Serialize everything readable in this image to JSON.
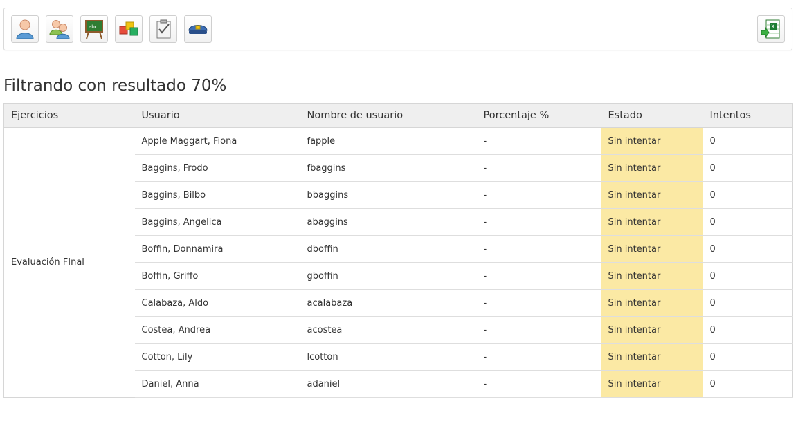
{
  "toolbar": {
    "buttons": [
      {
        "icon": "user-icon"
      },
      {
        "icon": "users-icon"
      },
      {
        "icon": "blackboard-icon"
      },
      {
        "icon": "cubes-icon"
      },
      {
        "icon": "clipboard-check-icon"
      },
      {
        "icon": "security-badge-icon"
      }
    ],
    "export": {
      "icon": "excel-export-icon"
    }
  },
  "page_title": "Filtrando con resultado 70%",
  "table": {
    "headers": [
      "Ejercicios",
      "Usuario",
      "Nombre de usuario",
      "Porcentaje %",
      "Estado",
      "Intentos"
    ],
    "exercise": "Evaluación FInal",
    "rows": [
      {
        "usuario": "Apple Maggart, Fiona",
        "username": "fapple",
        "porcentaje": "-",
        "estado": "Sin intentar",
        "intentos": "0"
      },
      {
        "usuario": "Baggins, Frodo",
        "username": "fbaggins",
        "porcentaje": "-",
        "estado": "Sin intentar",
        "intentos": "0"
      },
      {
        "usuario": "Baggins, Bilbo",
        "username": "bbaggins",
        "porcentaje": "-",
        "estado": "Sin intentar",
        "intentos": "0"
      },
      {
        "usuario": "Baggins, Angelica",
        "username": "abaggins",
        "porcentaje": "-",
        "estado": "Sin intentar",
        "intentos": "0"
      },
      {
        "usuario": "Boffin, Donnamira",
        "username": "dboffin",
        "porcentaje": "-",
        "estado": "Sin intentar",
        "intentos": "0"
      },
      {
        "usuario": "Boffin, Griffo",
        "username": "gboffin",
        "porcentaje": "-",
        "estado": "Sin intentar",
        "intentos": "0"
      },
      {
        "usuario": "Calabaza, Aldo",
        "username": "acalabaza",
        "porcentaje": "-",
        "estado": "Sin intentar",
        "intentos": "0"
      },
      {
        "usuario": "Costea, Andrea",
        "username": "acostea",
        "porcentaje": "-",
        "estado": "Sin intentar",
        "intentos": "0"
      },
      {
        "usuario": "Cotton, Lily",
        "username": "lcotton",
        "porcentaje": "-",
        "estado": "Sin intentar",
        "intentos": "0"
      },
      {
        "usuario": "Daniel, Anna",
        "username": "adaniel",
        "porcentaje": "-",
        "estado": "Sin intentar",
        "intentos": "0"
      }
    ]
  },
  "colors": {
    "estado_background": "#fbe9a4",
    "header_background": "#efefef"
  }
}
